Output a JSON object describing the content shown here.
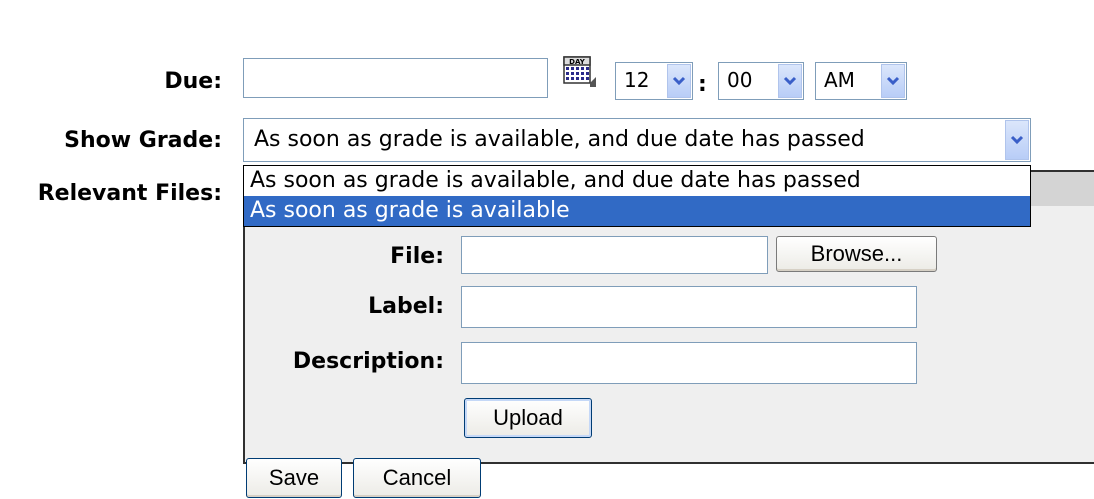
{
  "form": {
    "due_label": "Due:",
    "due_value": "",
    "calendar_icon_text": "DAY",
    "time_hour": "12",
    "time_separator": ":",
    "time_minute": "00",
    "time_ampm": "AM",
    "show_grade_label": "Show Grade:",
    "show_grade_value": "As soon as grade is available, and due date has passed",
    "show_grade_options": [
      "As soon as grade is available, and due date has passed",
      "As soon as grade is available"
    ],
    "relevant_files_label": "Relevant Files:"
  },
  "files": {
    "file_label": "File:",
    "file_value": "",
    "browse_label": "Browse...",
    "label_label": "Label:",
    "label_value": "",
    "description_label": "Description:",
    "description_value": "",
    "upload_label": "Upload"
  },
  "actions": {
    "save_label": "Save",
    "cancel_label": "Cancel"
  },
  "colors": {
    "selection_highlight": "#316ac5",
    "input_border": "#7f9db9",
    "button_border": "#003c74",
    "panel_background": "#efefef"
  }
}
